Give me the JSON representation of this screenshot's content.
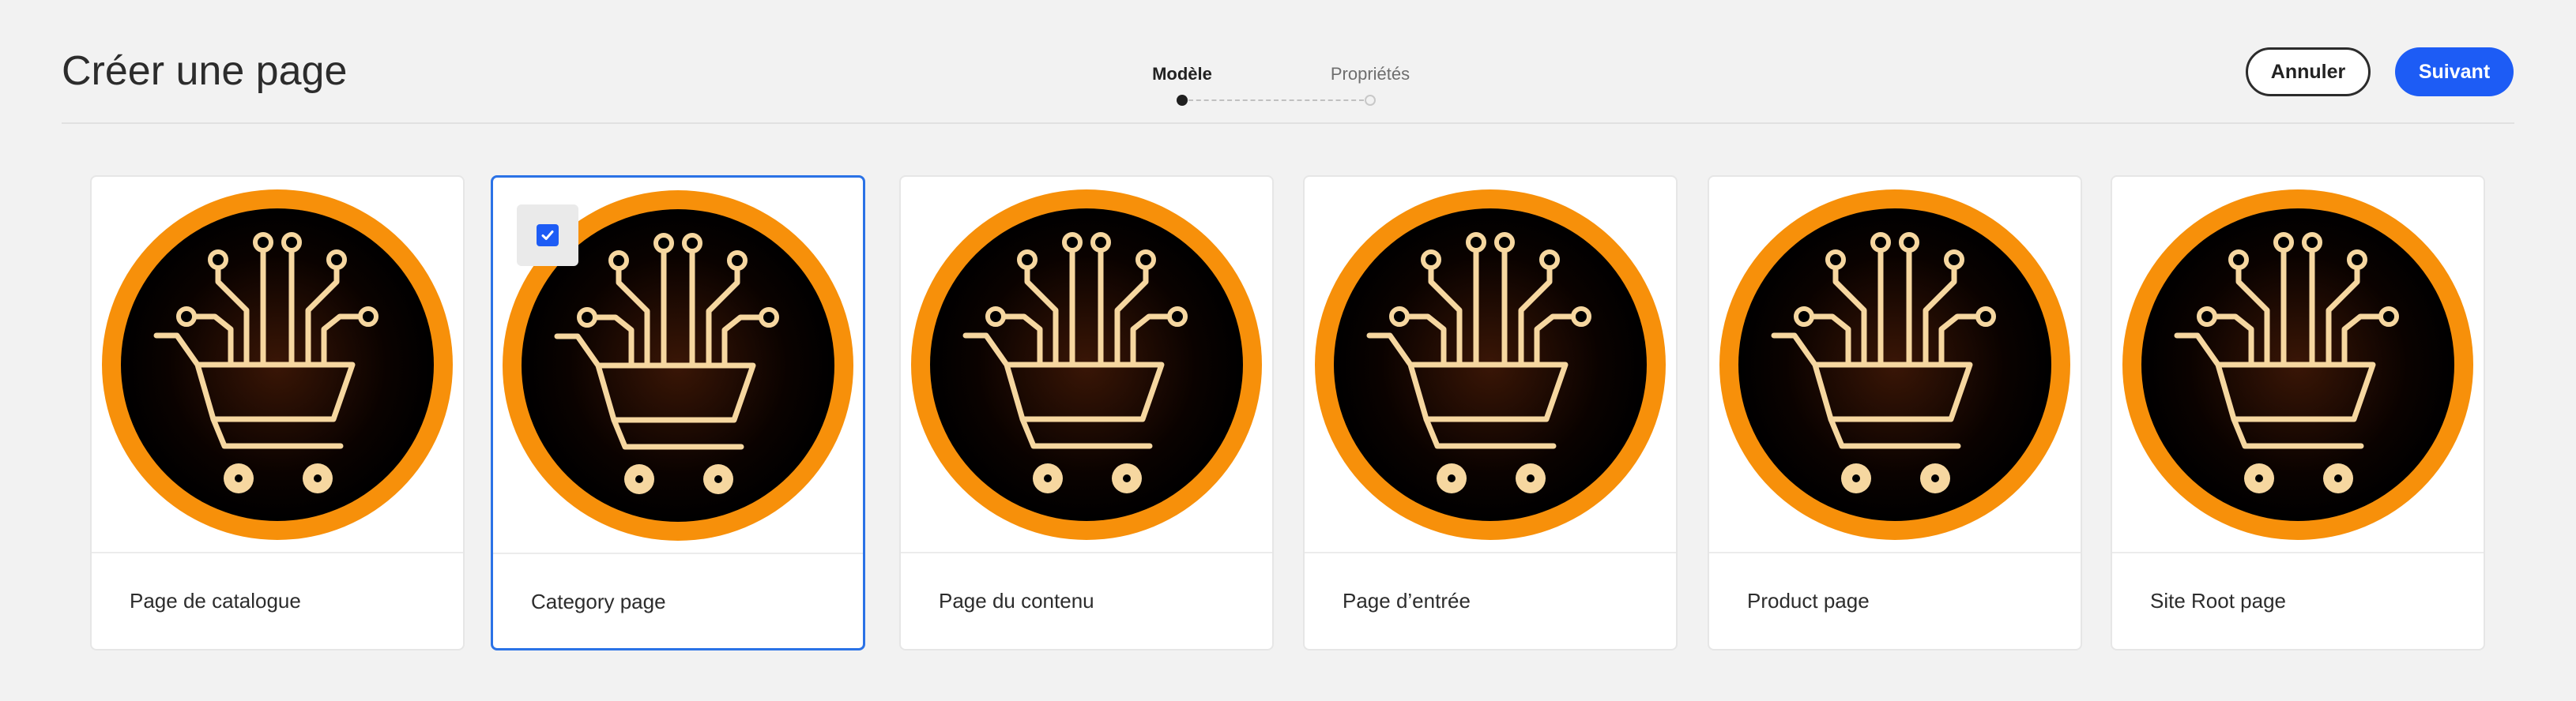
{
  "header": {
    "title": "Créer une page",
    "cancel_label": "Annuler",
    "next_label": "Suivant"
  },
  "stepper": {
    "steps": [
      {
        "label": "Modèle",
        "state": "active"
      },
      {
        "label": "Propriétés",
        "state": "inactive"
      }
    ]
  },
  "templates": {
    "items": [
      {
        "label": "Page de catalogue",
        "selected": false,
        "thumbnail_icon": "shopping-cart-circuit-icon"
      },
      {
        "label": "Category page",
        "selected": true,
        "thumbnail_icon": "shopping-cart-circuit-icon"
      },
      {
        "label": "Page du contenu",
        "selected": false,
        "thumbnail_icon": "shopping-cart-circuit-icon"
      },
      {
        "label": "Page d’entrée",
        "selected": false,
        "thumbnail_icon": "shopping-cart-circuit-icon"
      },
      {
        "label": "Product page",
        "selected": false,
        "thumbnail_icon": "shopping-cart-circuit-icon"
      },
      {
        "label": "Site Root page",
        "selected": false,
        "thumbnail_icon": "shopping-cart-circuit-icon"
      }
    ]
  },
  "colors": {
    "background": "#f2f2f2",
    "accent": "#1d5cf5",
    "selection_border": "#2b72e6",
    "thumbnail_ring": "#f7900a",
    "thumbnail_fill": "#000000",
    "thumbnail_glyph": "#f6d7a0"
  }
}
